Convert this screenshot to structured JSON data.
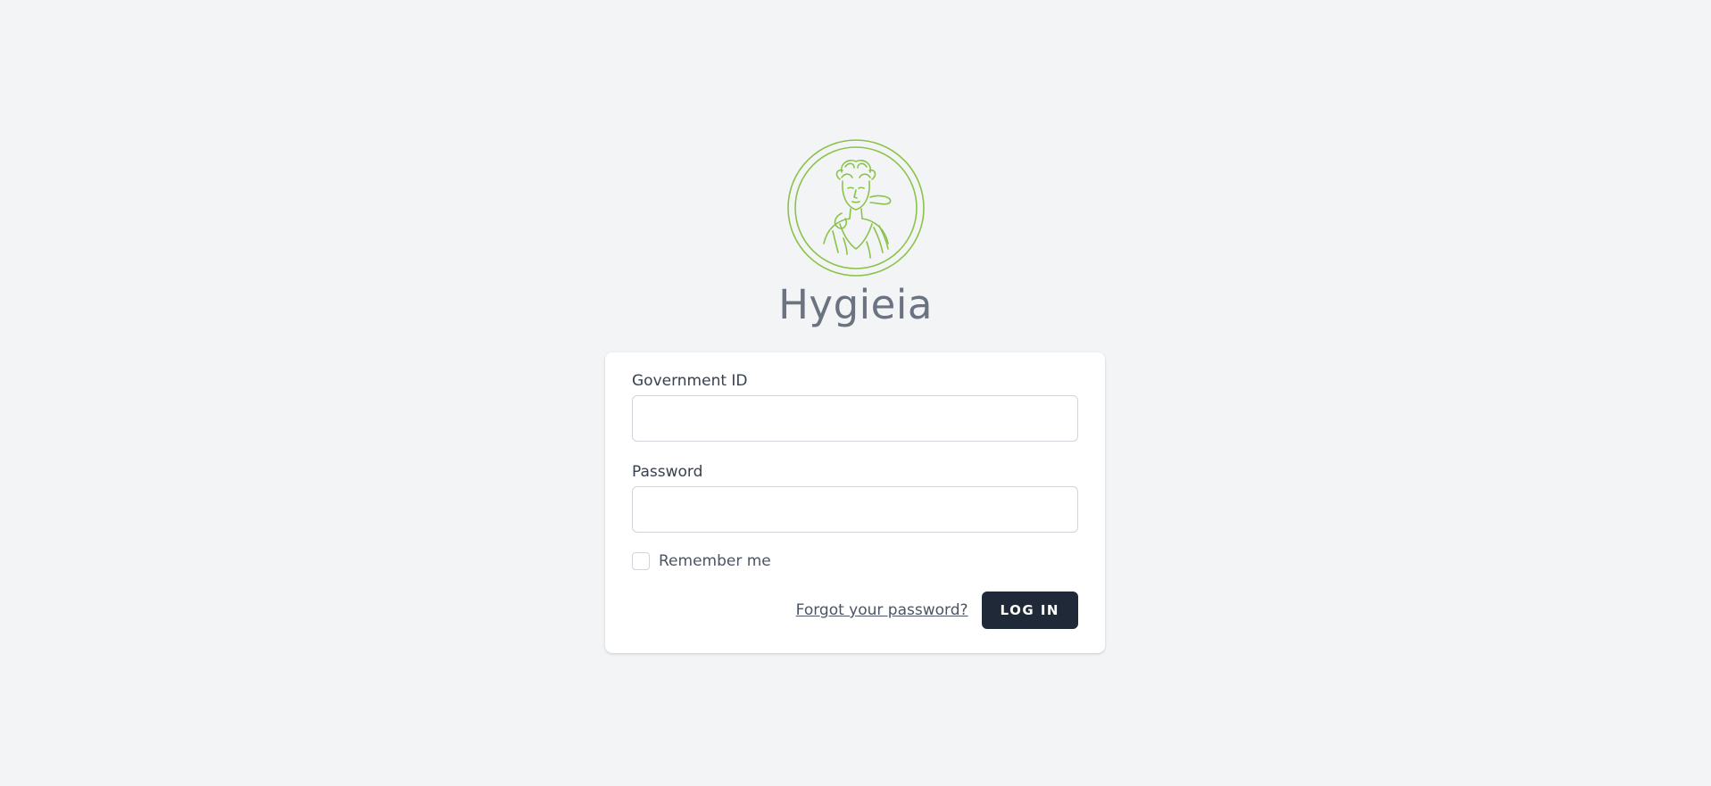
{
  "brand": {
    "title": "Hygieia",
    "logo_icon": "hygieia-goddess-portrait-icon",
    "logo_color": "#8bc34a"
  },
  "form": {
    "government_id_label": "Government ID",
    "government_id_value": "",
    "password_label": "Password",
    "password_value": "",
    "remember_label": "Remember me",
    "remember_checked": false,
    "forgot_password_label": "Forgot your password?",
    "login_label": "LOG IN"
  },
  "colors": {
    "background": "#f3f4f6",
    "card": "#ffffff",
    "button": "#1f2937",
    "title": "#6b7280"
  }
}
